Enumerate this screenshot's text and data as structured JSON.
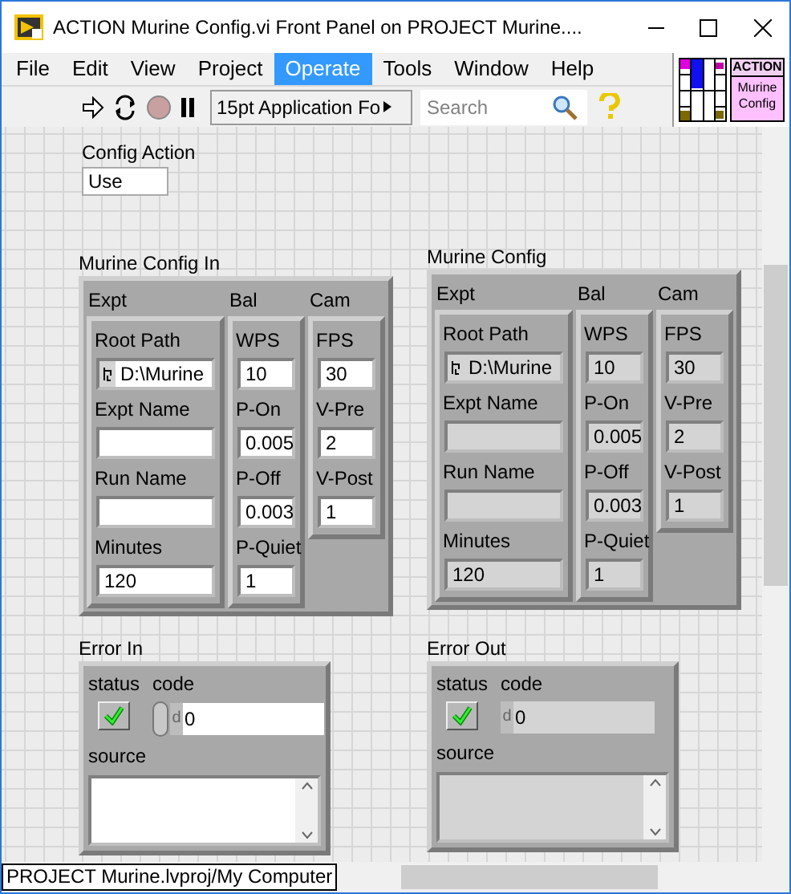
{
  "window": {
    "title": "ACTION Murine Config.vi Front Panel on PROJECT Murine...."
  },
  "menu": [
    {
      "label": "File",
      "selected": false
    },
    {
      "label": "Edit",
      "selected": false
    },
    {
      "label": "View",
      "selected": false
    },
    {
      "label": "Project",
      "selected": false
    },
    {
      "label": "Operate",
      "selected": true
    },
    {
      "label": "Tools",
      "selected": false
    },
    {
      "label": "Window",
      "selected": false
    },
    {
      "label": "Help",
      "selected": false
    }
  ],
  "toolbar": {
    "font_menu": "15pt Application Fo",
    "search": {
      "placeholder": "Search"
    }
  },
  "vi_icon": {
    "banner": "ACTION",
    "lines": [
      "Murine",
      "Config"
    ]
  },
  "config_action": {
    "label": "Config Action",
    "value": "Use"
  },
  "clusters": [
    {
      "label": "Murine Config In",
      "kind": "control",
      "columns": [
        {
          "label": "Expt",
          "fields": [
            {
              "label": "Root Path",
              "value": "D:\\Murine",
              "kind": "path"
            },
            {
              "label": "Expt Name",
              "kind": "string"
            },
            {
              "label": "Run Name",
              "kind": "string"
            },
            {
              "label": "Minutes",
              "value": "120",
              "kind": "number"
            }
          ]
        },
        {
          "label": "Bal",
          "fields": [
            {
              "label": "WPS",
              "value": "10",
              "kind": "number"
            },
            {
              "label": "P-On",
              "value": "0.005",
              "kind": "number"
            },
            {
              "label": "P-Off",
              "value": "0.003",
              "kind": "number"
            },
            {
              "label": "P-Quiet",
              "value": "1",
              "kind": "number"
            }
          ]
        },
        {
          "label": "Cam",
          "fields": [
            {
              "label": "FPS",
              "value": "30",
              "kind": "number"
            },
            {
              "label": "V-Pre",
              "value": "2",
              "kind": "number"
            },
            {
              "label": "V-Post",
              "value": "1",
              "kind": "number"
            }
          ]
        }
      ]
    },
    {
      "label": "Murine Config",
      "kind": "indicator",
      "columns": [
        {
          "label": "Expt",
          "fields": [
            {
              "label": "Root Path",
              "value": "D:\\Murine",
              "kind": "path"
            },
            {
              "label": "Expt Name",
              "kind": "string"
            },
            {
              "label": "Run Name",
              "kind": "string"
            },
            {
              "label": "Minutes",
              "value": "120",
              "kind": "number"
            }
          ]
        },
        {
          "label": "Bal",
          "fields": [
            {
              "label": "WPS",
              "value": "10",
              "kind": "number"
            },
            {
              "label": "P-On",
              "value": "0.005",
              "kind": "number"
            },
            {
              "label": "P-Off",
              "value": "0.003",
              "kind": "number"
            },
            {
              "label": "P-Quiet",
              "value": "1",
              "kind": "number"
            }
          ]
        },
        {
          "label": "Cam",
          "fields": [
            {
              "label": "FPS",
              "value": "30",
              "kind": "number"
            },
            {
              "label": "V-Pre",
              "value": "2",
              "kind": "number"
            },
            {
              "label": "V-Post",
              "value": "1",
              "kind": "number"
            }
          ]
        }
      ]
    }
  ],
  "errors": [
    {
      "label": "Error In",
      "kind": "control",
      "status_label": "status",
      "status": true,
      "code_label": "code",
      "radix": "d",
      "code": "0",
      "source_label": "source"
    },
    {
      "label": "Error Out",
      "kind": "indicator",
      "status_label": "status",
      "status": true,
      "code_label": "code",
      "radix": "d",
      "code": "0",
      "source_label": "source"
    }
  ],
  "status_bar": "PROJECT Murine.lvproj/My Computer"
}
